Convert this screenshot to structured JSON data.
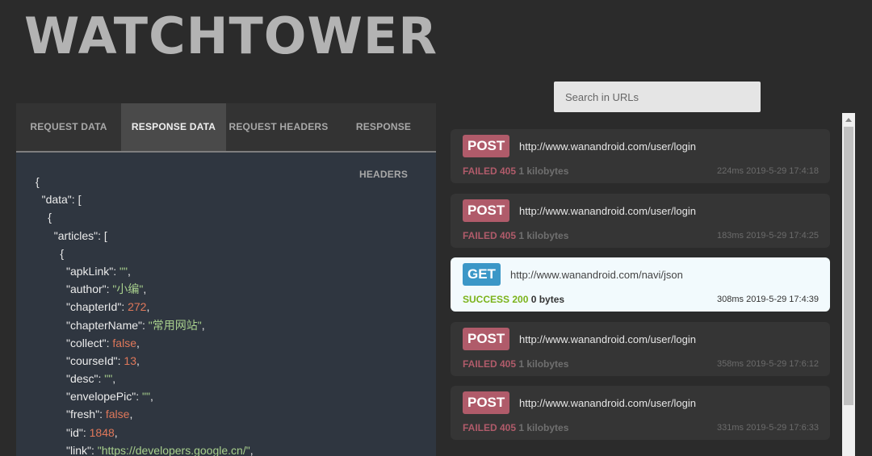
{
  "app": {
    "title": "WATCHTOWER"
  },
  "tabs": [
    {
      "label": "REQUEST DATA",
      "active": false
    },
    {
      "label": "RESPONSE DATA",
      "active": true
    },
    {
      "label": "REQUEST HEADERS",
      "active": false
    },
    {
      "label": "RESPONSE HEADERS",
      "active": false
    }
  ],
  "search": {
    "placeholder": "Search in URLs",
    "value": ""
  },
  "json_view": {
    "lines": [
      {
        "indent": 0,
        "key": "",
        "value": "{",
        "type": "punct"
      },
      {
        "indent": 1,
        "key": "\"data\"",
        "value": "[",
        "type": "punct"
      },
      {
        "indent": 2,
        "key": "",
        "value": "{",
        "type": "punct"
      },
      {
        "indent": 3,
        "key": "\"articles\"",
        "value": "[",
        "type": "punct"
      },
      {
        "indent": 4,
        "key": "",
        "value": "{",
        "type": "punct"
      },
      {
        "indent": 5,
        "key": "\"apkLink\"",
        "value": "\"\"",
        "type": "string"
      },
      {
        "indent": 5,
        "key": "\"author\"",
        "value": "\"小编\"",
        "type": "string"
      },
      {
        "indent": 5,
        "key": "\"chapterId\"",
        "value": "272",
        "type": "number"
      },
      {
        "indent": 5,
        "key": "\"chapterName\"",
        "value": "\"常用网站\"",
        "type": "string"
      },
      {
        "indent": 5,
        "key": "\"collect\"",
        "value": "false",
        "type": "bool"
      },
      {
        "indent": 5,
        "key": "\"courseId\"",
        "value": "13",
        "type": "number"
      },
      {
        "indent": 5,
        "key": "\"desc\"",
        "value": "\"\"",
        "type": "string"
      },
      {
        "indent": 5,
        "key": "\"envelopePic\"",
        "value": "\"\"",
        "type": "string"
      },
      {
        "indent": 5,
        "key": "\"fresh\"",
        "value": "false",
        "type": "bool"
      },
      {
        "indent": 5,
        "key": "\"id\"",
        "value": "1848",
        "type": "number"
      },
      {
        "indent": 5,
        "key": "\"link\"",
        "value": "\"https://developers.google.cn/\"",
        "type": "string"
      }
    ]
  },
  "requests": [
    {
      "method": "POST",
      "url": "http://www.wanandroid.com/user/login",
      "status": "FAILED 405",
      "size": "1 kilobytes",
      "time": "224ms",
      "date": "2019-5-29 17:4:18",
      "selected": false,
      "ok": false
    },
    {
      "method": "POST",
      "url": "http://www.wanandroid.com/user/login",
      "status": "FAILED 405",
      "size": "1 kilobytes",
      "time": "183ms",
      "date": "2019-5-29 17:4:25",
      "selected": false,
      "ok": false
    },
    {
      "method": "GET",
      "url": "http://www.wanandroid.com/navi/json",
      "status": "SUCCESS 200",
      "size": "0 bytes",
      "time": "308ms",
      "date": "2019-5-29 17:4:39",
      "selected": true,
      "ok": true
    },
    {
      "method": "POST",
      "url": "http://www.wanandroid.com/user/login",
      "status": "FAILED 405",
      "size": "1 kilobytes",
      "time": "358ms",
      "date": "2019-5-29 17:6:12",
      "selected": false,
      "ok": false
    },
    {
      "method": "POST",
      "url": "http://www.wanandroid.com/user/login",
      "status": "FAILED 405",
      "size": "1 kilobytes",
      "time": "331ms",
      "date": "2019-5-29 17:6:33",
      "selected": false,
      "ok": false
    }
  ],
  "colors": {
    "post": "#b05b6a",
    "get": "#3b97c7",
    "failed": "#b05b6a",
    "success": "#7bb31a",
    "selected_card": "#f2fafd"
  }
}
